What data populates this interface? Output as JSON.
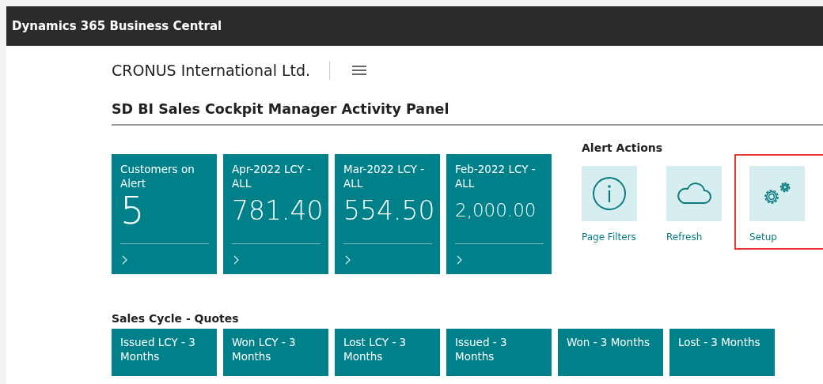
{
  "app_bar": {
    "title": "Dynamics 365 Business Central"
  },
  "company": {
    "name": "CRONUS International Ltd."
  },
  "page": {
    "title": "SD BI Sales Cockpit Manager Activity Panel"
  },
  "cue_tiles": [
    {
      "label": "Customers on Alert",
      "value": "5"
    },
    {
      "label": "Apr-2022 LCY - ALL",
      "value": "781.40"
    },
    {
      "label": "Mar-2022 LCY - ALL",
      "value": "554.50"
    },
    {
      "label": "Feb-2022 LCY - ALL",
      "value": "2,000.00"
    }
  ],
  "alert_actions": {
    "title": "Alert Actions",
    "items": [
      {
        "kind": "info",
        "label": "Page Filters",
        "highlighted": false
      },
      {
        "kind": "cloud",
        "label": "Refresh",
        "highlighted": false
      },
      {
        "kind": "gears",
        "label": "Setup",
        "highlighted": true
      }
    ]
  },
  "sales_cycle": {
    "title": "Sales Cycle - Quotes",
    "tiles": [
      {
        "label": "Issued LCY - 3 Months"
      },
      {
        "label": "Won LCY - 3 Months"
      },
      {
        "label": "Lost LCY - 3 Months"
      },
      {
        "label": "Issued - 3 Months"
      },
      {
        "label": "Won - 3 Months"
      },
      {
        "label": "Lost - 3 Months"
      }
    ]
  }
}
